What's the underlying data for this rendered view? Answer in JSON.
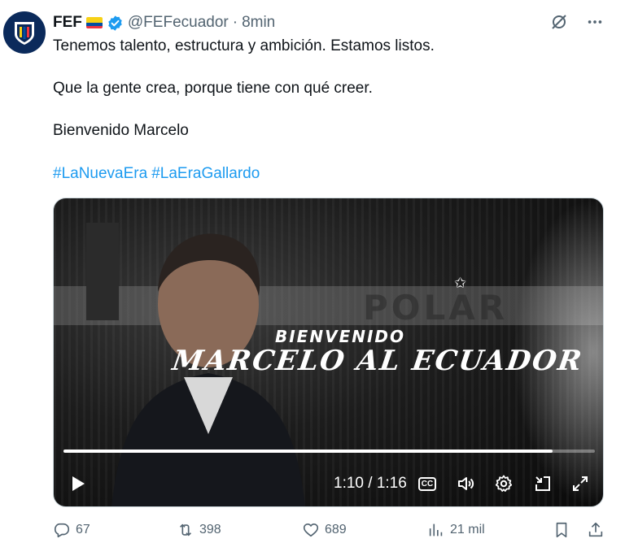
{
  "author": {
    "name": "FEF",
    "handle": "@FEFecuador",
    "separator": "·",
    "time": "8min"
  },
  "tweet": {
    "line1": "Tenemos talento, estructura y ambición. Estamos listos.",
    "line2": "Que la gente crea, porque tiene con qué creer.",
    "line3": "Bienvenido Marcelo",
    "hashtags": [
      "#LaNuevaEra",
      "#LaEraGallardo"
    ]
  },
  "video": {
    "overlay_small": "BIENVENIDO",
    "overlay_large": "MARCELO AL ECUADOR",
    "banner_text": "POLAR",
    "timecode": "1:10 / 1:16",
    "progress": 0.92,
    "cc_label": "CC"
  },
  "metrics": {
    "replies": "67",
    "retweets": "398",
    "likes": "689",
    "views": "21 mil"
  },
  "colors": {
    "link": "#1d9bf0",
    "muted": "#536471",
    "verified": "#1d9bf0"
  },
  "icons": {
    "grok": "grok-icon",
    "more": "more-icon",
    "reply": "reply-icon",
    "retweet": "retweet-icon",
    "like": "heart-icon",
    "views": "views-icon",
    "bookmark": "bookmark-icon",
    "share": "share-icon"
  }
}
